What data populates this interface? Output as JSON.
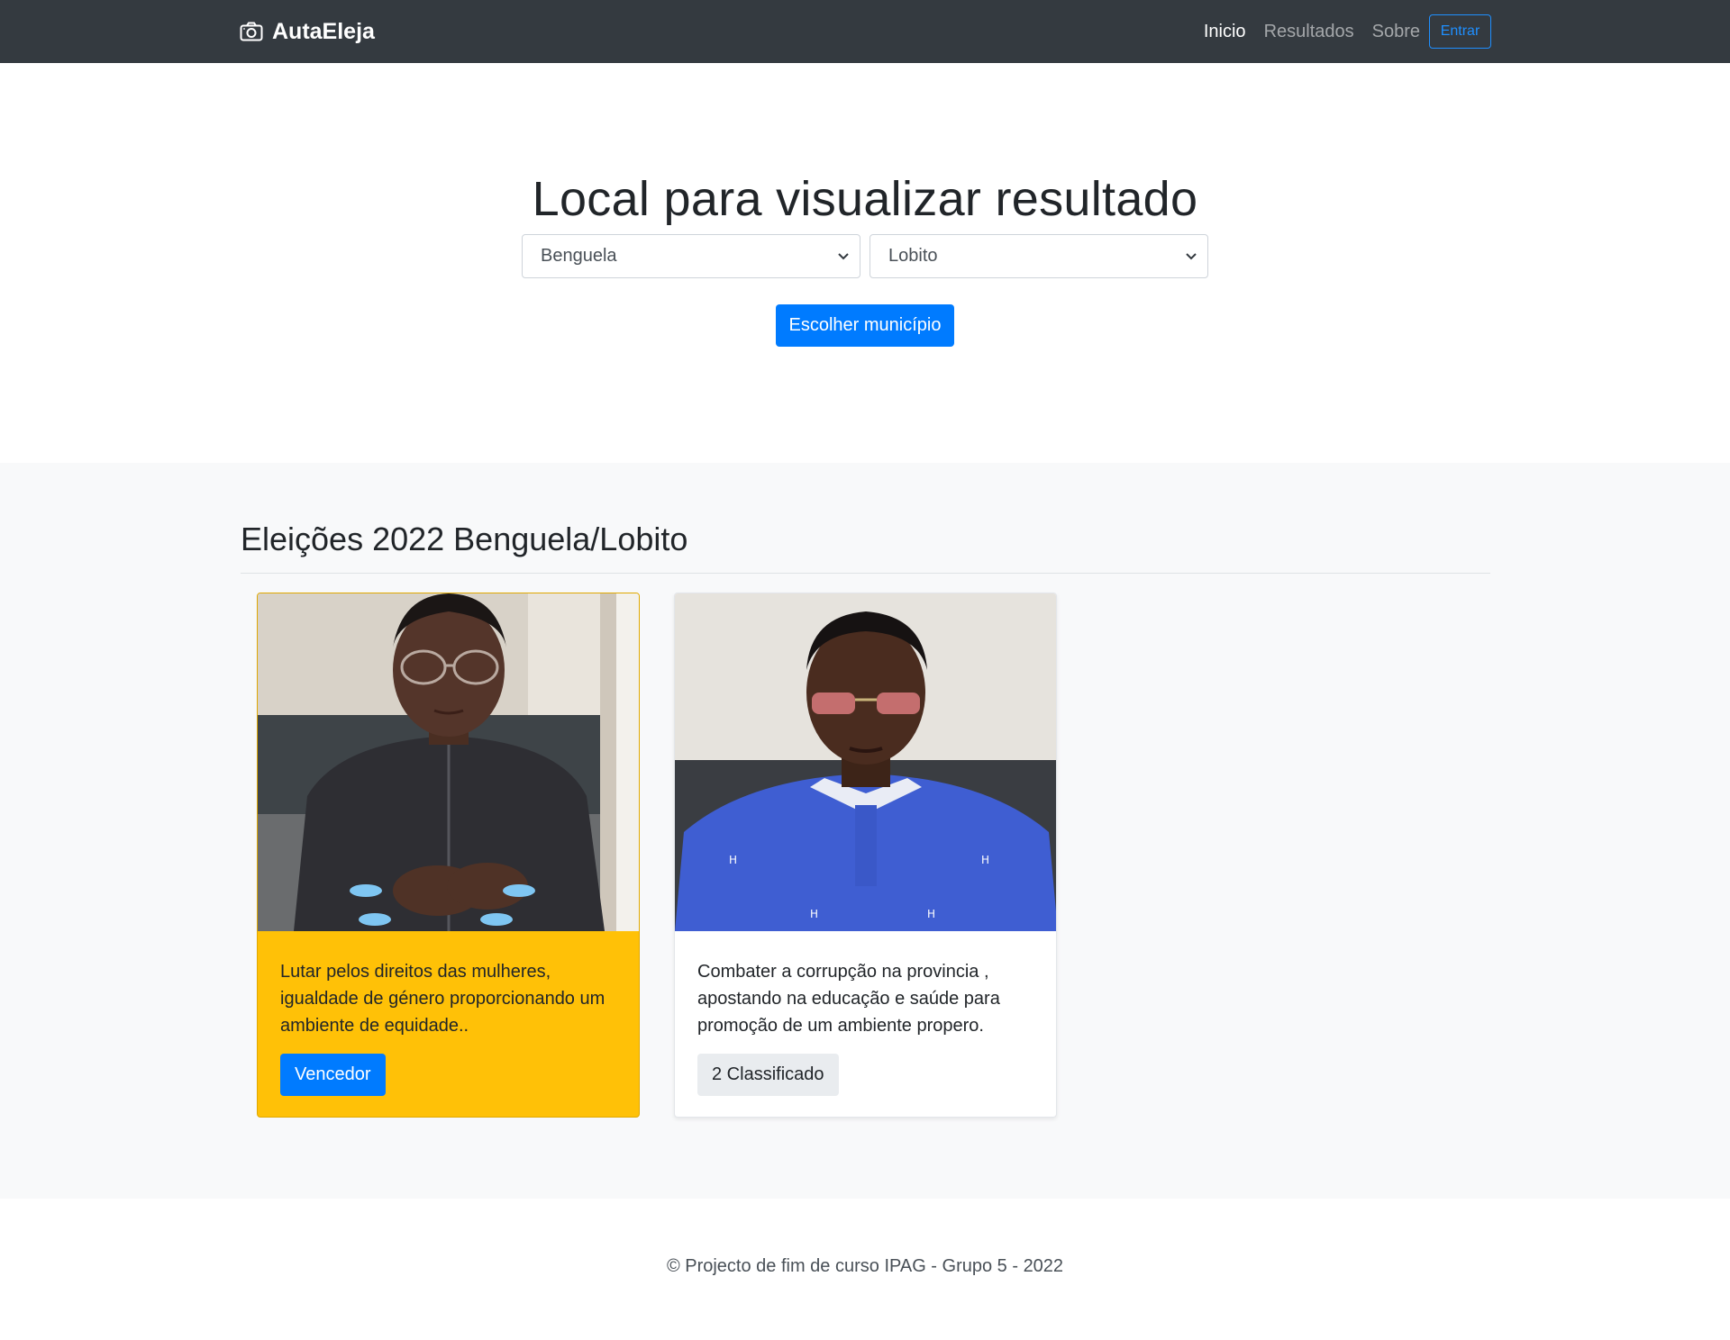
{
  "navbar": {
    "brand": "AutaEleja",
    "brand_icon": "camera-icon",
    "links": [
      {
        "label": "Inicio",
        "active": true
      },
      {
        "label": "Resultados",
        "active": false
      },
      {
        "label": "Sobre",
        "active": false
      }
    ],
    "login_label": "Entrar"
  },
  "hero": {
    "title": "Local para visualizar resultado",
    "province_select": {
      "selected": "Benguela"
    },
    "municipality_select": {
      "selected": "Lobito"
    },
    "choose_button": "Escolher município"
  },
  "results": {
    "title": "Eleições 2022 Benguela/Lobito",
    "candidates": [
      {
        "photo": "candidate-photo-woman",
        "description": "Lutar pelos direitos das mulheres, igualdade de género proporcionando um ambiente de equidade..",
        "rank_label": "Vencedor",
        "highlight_color": "#ffc107"
      },
      {
        "photo": "candidate-photo-man",
        "description": "Combater a corrupção na provincia , apostando na educação e saúde para promoção de um ambiente propero.",
        "rank_label": "2 Classificado",
        "highlight_color": "#ffffff"
      }
    ]
  },
  "footer": {
    "text": "© Projecto de fim de curso IPAG - Grupo 5 - 2022"
  },
  "colors": {
    "navbar": "#343a40",
    "primary": "#007bff",
    "warning": "#ffc107",
    "section_bg": "#f8f9fa"
  }
}
